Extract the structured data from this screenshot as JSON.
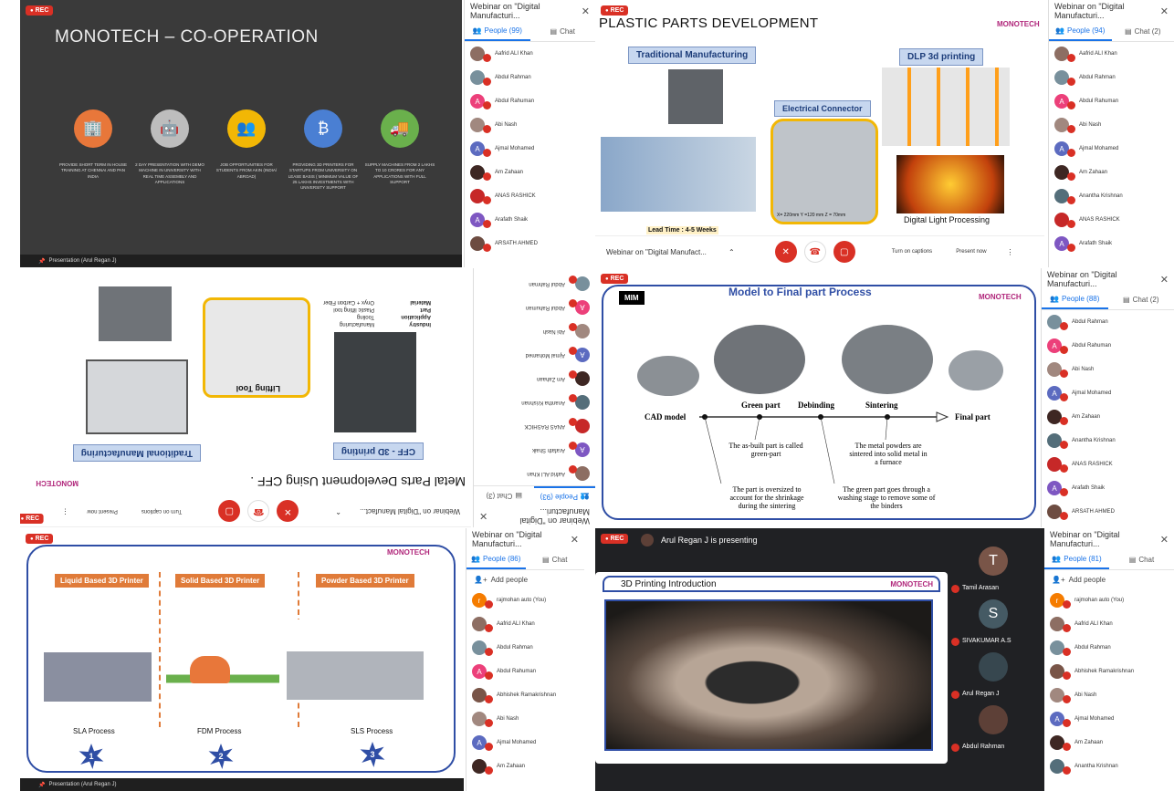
{
  "tile1": {
    "rec": "REC",
    "slide_title": "MONOTECH – CO-OPERATION",
    "items": [
      {
        "icon": "building-icon",
        "color": "#e8773a",
        "text": "PROVIDE SHORT TERM IN HOUSE TRAINING AT CHENNAI AND PAN INDIA"
      },
      {
        "icon": "robot-icon",
        "color": "#bdbdbd",
        "text": "2 DAY PRESENTATION WITH DEMO MACHINE IN UNIVERSITY WITH REAL TIME ASSEMBLY AND APPLICATIONS"
      },
      {
        "icon": "people-icon",
        "color": "#f2b705",
        "text": "JOB OPPORTUNITIES FOR STUDENTS FROM AKIN (INDIA/ ABROAD)"
      },
      {
        "icon": "bitcoin-icon",
        "color": "#4a7fd3",
        "text": "PROVIDING 3D PRINTERS FOR STARTUPS FROM UNIVERSITY ON LEASE BASIS ( MINIMUM VALUE OF 25 LAKHS INVESTMENTS WITH UNIVERSITY SUPPORT"
      },
      {
        "icon": "truck-icon",
        "color": "#6ab04c",
        "text": "SUPPLY MACHINES FROM 2 LAKHS TO 10 CRORES FOR ANY APPLICATIONS WITH FULL SUPPORT"
      }
    ],
    "presentation": "Presentation (Arul Regan J)",
    "panel_title": "Webinar on \"Digital Manufacturi...",
    "people_tab": "People (99)",
    "chat_tab": "Chat",
    "people": [
      {
        "name": "Aafrid ALI Khan",
        "color": "#8d6e63",
        "initial": ""
      },
      {
        "name": "Abdul Rahman",
        "color": "#78909c",
        "initial": ""
      },
      {
        "name": "Abdul Rahuman",
        "color": "#ec407a",
        "initial": "A"
      },
      {
        "name": "Abi Nash",
        "color": "#a1887f",
        "initial": ""
      },
      {
        "name": "Ajmal Mohamed",
        "color": "#5c6bc0",
        "initial": "A"
      },
      {
        "name": "Am Zahaan",
        "color": "#3e2723",
        "initial": ""
      },
      {
        "name": "ANAS RASHICK",
        "color": "#c62828",
        "initial": ""
      },
      {
        "name": "Arafath Shaik",
        "color": "#7e57c2",
        "initial": "A"
      },
      {
        "name": "ARSATH AHMED",
        "color": "#6d4c41",
        "initial": ""
      }
    ]
  },
  "tile2": {
    "rec": "REC",
    "slide_title": "PLASTIC PARTS DEVELOPMENT",
    "logo": "MONOTECH",
    "label_traditional": "Traditional Manufacturing",
    "label_dlp": "DLP 3d printing",
    "label_connector": "Electrical Connector",
    "dims": "X= 220mm Y =120 mm Z = 70mm",
    "lead_time": "Lead Time    : 4-5 Weeks",
    "dlp_caption": "Digital Light Processing",
    "meeting_name": "Webinar on \"Digital Manufact...",
    "captions": "Turn on captions",
    "present": "Present now",
    "panel_title": "Webinar on \"Digital Manufacturi...",
    "people_tab": "People (94)",
    "chat_tab": "Chat (2)",
    "people": [
      {
        "name": "Aafrid ALI Khan",
        "color": "#8d6e63",
        "initial": ""
      },
      {
        "name": "Abdul Rahman",
        "color": "#78909c",
        "initial": ""
      },
      {
        "name": "Abdul Rahuman",
        "color": "#ec407a",
        "initial": "A"
      },
      {
        "name": "Abi Nash",
        "color": "#a1887f",
        "initial": ""
      },
      {
        "name": "Ajmal Mohamed",
        "color": "#5c6bc0",
        "initial": "A"
      },
      {
        "name": "Am Zahaan",
        "color": "#3e2723",
        "initial": ""
      },
      {
        "name": "Anantha Krishnan",
        "color": "#546e7a",
        "initial": ""
      },
      {
        "name": "ANAS RASHICK",
        "color": "#c62828",
        "initial": ""
      },
      {
        "name": "Arafath Shaik",
        "color": "#7e57c2",
        "initial": "A"
      }
    ]
  },
  "tile3": {
    "rec": "REC",
    "slide_title": "Metal Parts Development Using CFF .",
    "logo": "MONOTECH",
    "label_traditional": "Traditional Manufacturing",
    "label_cff": "CFF - 3D printing",
    "lifting_tool": "Lifting Tool",
    "spec_labels": [
      "Industry",
      "Application",
      "Part",
      "Material"
    ],
    "spec_values": [
      "Manufacturing",
      "Tooling",
      "Plastic lifting tool",
      "Onyx + Carbon Fiber"
    ],
    "meeting_name": "Webinar on \"Digital Manufact...",
    "captions": "Turn on captions",
    "present": "Present now",
    "panel_title": "Webinar on \"Digital Manufacturi...",
    "people_tab": "People (93)",
    "chat_tab": "Chat (3)",
    "people": [
      {
        "name": "Aafrid ALI Khan",
        "color": "#8d6e63",
        "initial": ""
      },
      {
        "name": "Arafath Shaik",
        "color": "#7e57c2",
        "initial": "A"
      },
      {
        "name": "ANAS RASHICK",
        "color": "#c62828",
        "initial": ""
      },
      {
        "name": "Anantha Krishnan",
        "color": "#546e7a",
        "initial": ""
      },
      {
        "name": "Am Zahaan",
        "color": "#3e2723",
        "initial": ""
      },
      {
        "name": "Ajmal Mohamed",
        "color": "#5c6bc0",
        "initial": "A"
      },
      {
        "name": "Abi Nash",
        "color": "#a1887f",
        "initial": ""
      },
      {
        "name": "Abdul Rahuman",
        "color": "#ec407a",
        "initial": "A"
      },
      {
        "name": "Abdul Rahman",
        "color": "#78909c",
        "initial": ""
      }
    ]
  },
  "tile4": {
    "rec": "REC",
    "mim": "MIM",
    "slide_title": "Model to Final part Process",
    "logo": "MONOTECH",
    "stages": [
      "CAD model",
      "Green part",
      "Debinding",
      "Sintering",
      "Final part"
    ],
    "notes": [
      "The as-built part is called green-part",
      "The metal powders are sintered into solid metal in a furnace",
      "The part is oversized to account for the shrinkage during the sintering",
      "The green part goes through a washing stage to remove some of the binders"
    ],
    "panel_title": "Webinar on \"Digital Manufacturi...",
    "people_tab": "People (88)",
    "chat_tab": "Chat (2)",
    "people": [
      {
        "name": "Abdul Rahman",
        "color": "#78909c",
        "initial": ""
      },
      {
        "name": "Abdul Rahuman",
        "color": "#ec407a",
        "initial": "A"
      },
      {
        "name": "Abi Nash",
        "color": "#a1887f",
        "initial": ""
      },
      {
        "name": "Ajmal Mohamed",
        "color": "#5c6bc0",
        "initial": "A"
      },
      {
        "name": "Am Zahaan",
        "color": "#3e2723",
        "initial": ""
      },
      {
        "name": "Anantha Krishnan",
        "color": "#546e7a",
        "initial": ""
      },
      {
        "name": "ANAS RASHICK",
        "color": "#c62828",
        "initial": ""
      },
      {
        "name": "Arafath Shaik",
        "color": "#7e57c2",
        "initial": "A"
      },
      {
        "name": "ARSATH AHMED",
        "color": "#6d4c41",
        "initial": ""
      }
    ]
  },
  "tile5": {
    "rec": "REC",
    "logo": "MONOTECH",
    "labels": [
      "Liquid Based 3D Printer",
      "Solid Based 3D Printer",
      "Powder Based 3D Printer"
    ],
    "captions": [
      "SLA Process",
      "FDM Process",
      "SLS Process"
    ],
    "numbers": [
      "1",
      "2",
      "3"
    ],
    "presentation": "Presentation (Arul Regan J)",
    "panel_title": "Webinar on \"Digital Manufacturi...",
    "people_tab": "People (86)",
    "chat_tab": "Chat",
    "add_people": "Add people",
    "people": [
      {
        "name": "rajmohan auto (You)",
        "color": "#f57c00",
        "initial": "r"
      },
      {
        "name": "Aafrid ALI Khan",
        "color": "#8d6e63",
        "initial": ""
      },
      {
        "name": "Abdul Rahman",
        "color": "#78909c",
        "initial": ""
      },
      {
        "name": "Abdul Rahuman",
        "color": "#ec407a",
        "initial": "A"
      },
      {
        "name": "Abhishek Ramakrishnan",
        "color": "#795548",
        "initial": ""
      },
      {
        "name": "Abi Nash",
        "color": "#a1887f",
        "initial": ""
      },
      {
        "name": "Ajmal Mohamed",
        "color": "#5c6bc0",
        "initial": "A"
      },
      {
        "name": "Am Zahaan",
        "color": "#3e2723",
        "initial": ""
      }
    ]
  },
  "tile6": {
    "rec": "REC",
    "presenting": "Arul Regan J is presenting",
    "slide_title": "3D Printing Introduction",
    "logo": "MONOTECH",
    "tiles": [
      {
        "name": "Tamil Arasan",
        "initial": "T",
        "color": "#795548"
      },
      {
        "name": "SIVAKUMAR A.S",
        "initial": "S",
        "color": "#455a64"
      },
      {
        "name": "Arul Regan J",
        "initial": "",
        "color": "#37474f"
      },
      {
        "name": "Abdul Rahman",
        "initial": "",
        "color": "#5d4037"
      }
    ],
    "panel_title": "Webinar on \"Digital Manufacturi...",
    "people_tab": "People (81)",
    "chat_tab": "Chat",
    "add_people": "Add people",
    "people": [
      {
        "name": "rajmohan auto (You)",
        "color": "#f57c00",
        "initial": "r"
      },
      {
        "name": "Aafrid ALI Khan",
        "color": "#8d6e63",
        "initial": ""
      },
      {
        "name": "Abdul Rahman",
        "color": "#78909c",
        "initial": ""
      },
      {
        "name": "Abhishek Ramakrishnan",
        "color": "#795548",
        "initial": ""
      },
      {
        "name": "Abi Nash",
        "color": "#a1887f",
        "initial": ""
      },
      {
        "name": "Ajmal Mohamed",
        "color": "#5c6bc0",
        "initial": "A"
      },
      {
        "name": "Am Zahaan",
        "color": "#3e2723",
        "initial": ""
      },
      {
        "name": "Anantha Krishnan",
        "color": "#546e7a",
        "initial": ""
      }
    ]
  }
}
